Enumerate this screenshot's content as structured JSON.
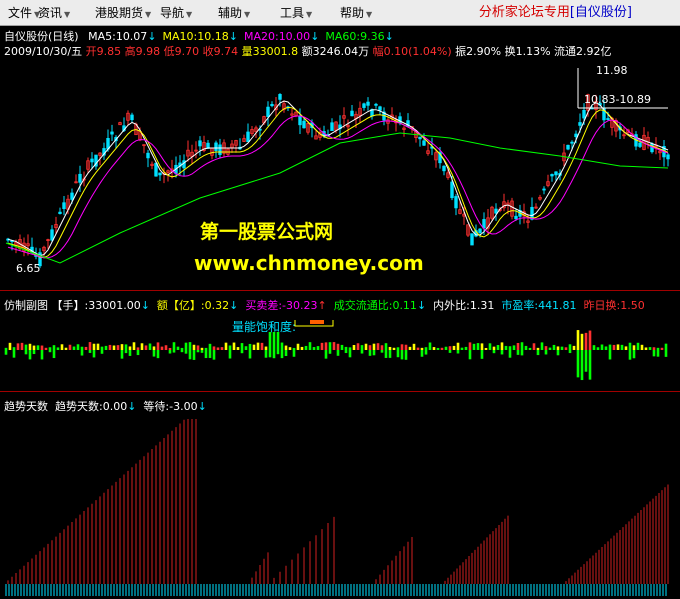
{
  "menu": [
    {
      "label": "文件",
      "icon": "chevron-down-icon"
    },
    {
      "label": "资讯",
      "icon": "chevron-down-icon"
    },
    {
      "label": "港股期货",
      "icon": "chevron-down-icon"
    },
    {
      "label": "导航",
      "icon": "chevron-down-icon"
    },
    {
      "label": "辅助",
      "icon": "chevron-down-icon"
    },
    {
      "label": "工具",
      "icon": "chevron-down-icon"
    },
    {
      "label": "帮助",
      "icon": "chevron-down-icon"
    }
  ],
  "brand": {
    "title": "分析家论坛专用",
    "stock": "[自仪股份]"
  },
  "main_chart": {
    "stock_name": "自仪股份(日线)",
    "ma": [
      {
        "label": "MA5:10.07",
        "color": "#ffffff"
      },
      {
        "label": "MA10:10.18",
        "color": "#ffff00"
      },
      {
        "label": "MA20:10.00",
        "color": "#ff00ff"
      },
      {
        "label": "MA60:9.36",
        "color": "#00ff00"
      }
    ],
    "info": {
      "date": "2009/10/30/五",
      "open_label": "开",
      "open": "9.85",
      "high_label": "高",
      "high": "9.98",
      "low_label": "低",
      "low": "9.70",
      "close_label": "收",
      "close": "9.74",
      "volume_label": "量",
      "volume": "33001.8",
      "amount_label": "额",
      "amount": "3246.04万",
      "change_label": "幅",
      "change": "0.10(1.04%)",
      "amplitude": "振2.90%",
      "turnover": "换1.13%",
      "float": "流通2.92亿"
    },
    "high_marker": "11.98",
    "range_marker": "10.83-10.89",
    "low_marker": "6.65",
    "watermark_title": "第一股票公式网",
    "watermark_url": "www.chnmoney.com",
    "arrow_symbol": "↓",
    "up_symbol": "↑",
    "colors": {
      "up": "#ff3030",
      "down": "#00e0ff",
      "ma5": "#ffffff",
      "ma10": "#ffff00",
      "ma20": "#ff00ff",
      "ma60": "#00ff00"
    }
  },
  "sub_chart1": {
    "title": "仿制副图",
    "vol_label": "【手】",
    "vol": ":33001.00",
    "amt_label": "额【亿】",
    "amt": ":0.32",
    "buysell_label": "买卖差",
    "buysell": ":-30.23",
    "ratio": "成交流通比:0.11",
    "inner_outer": "内外比:1.31",
    "pe": "市盈率:441.81",
    "prev_turnover": "昨日换:1.50",
    "saturation_label": "量能饱和度:"
  },
  "sub_chart2": {
    "title": "趋势天数",
    "days": "趋势天数:0.00",
    "wait": "等待:-3.00"
  }
}
